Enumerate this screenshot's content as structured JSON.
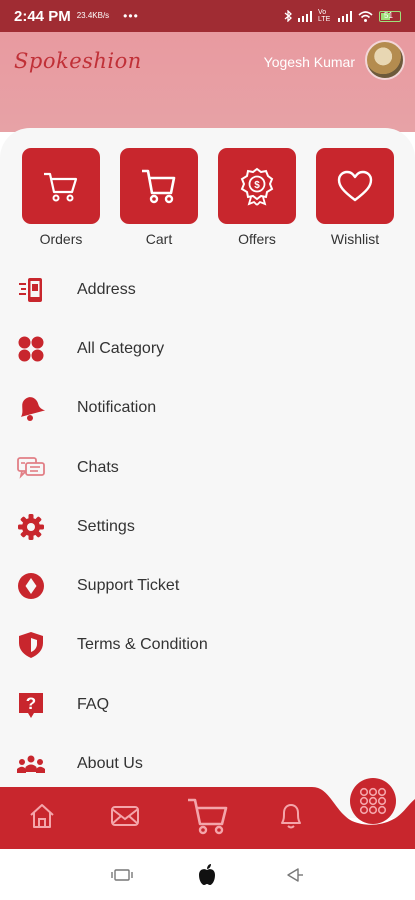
{
  "status_bar": {
    "time": "2:44 PM",
    "speed": "23.4KB/s",
    "dots": "•••",
    "carrier": "Vo LTE",
    "battery": "51"
  },
  "header": {
    "logo": "Spokeshion",
    "username": "Yogesh Kumar"
  },
  "quick_actions": [
    {
      "label": "Orders",
      "icon": "cart-icon"
    },
    {
      "label": "Cart",
      "icon": "cart-icon"
    },
    {
      "label": "Offers",
      "icon": "offer-badge-icon"
    },
    {
      "label": "Wishlist",
      "icon": "heart-icon"
    }
  ],
  "menu": [
    {
      "label": "Address",
      "icon": "phone-address-icon"
    },
    {
      "label": "All Category",
      "icon": "grid-icon"
    },
    {
      "label": "Notification",
      "icon": "bell-icon"
    },
    {
      "label": "Chats",
      "icon": "chat-icon"
    },
    {
      "label": "Settings",
      "icon": "gear-icon"
    },
    {
      "label": "Support Ticket",
      "icon": "ticket-icon"
    },
    {
      "label": "Terms & Condition",
      "icon": "shield-icon"
    },
    {
      "label": "FAQ",
      "icon": "question-icon"
    },
    {
      "label": "About Us",
      "icon": "team-icon"
    }
  ],
  "bottom_nav": [
    "home-icon",
    "mail-icon",
    "cart-icon",
    "bell-icon",
    "menu-grid-icon"
  ],
  "colors": {
    "accent": "#c8262d",
    "header": "#e89aa0",
    "background": "#f7f7f7"
  }
}
